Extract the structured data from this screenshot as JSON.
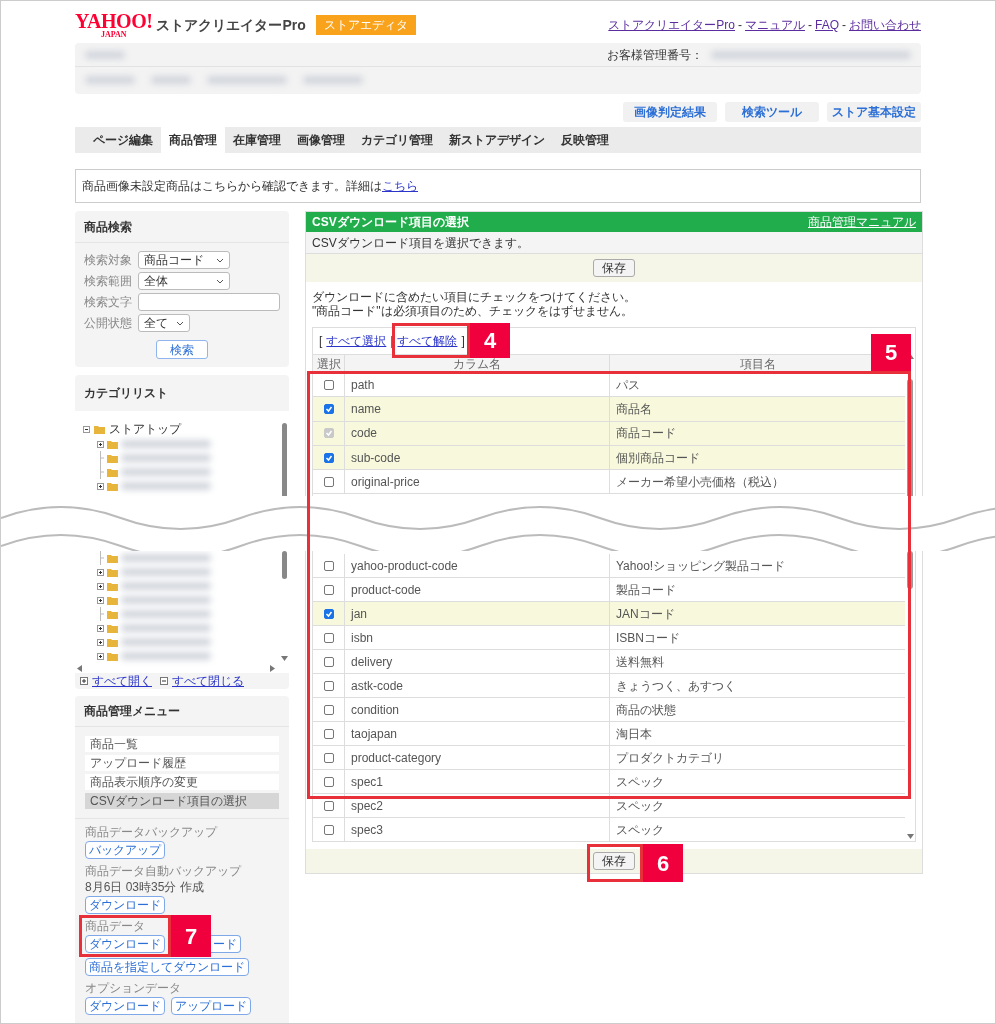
{
  "header": {
    "logo": {
      "main": "YAHOO!",
      "sub": "JAPAN"
    },
    "product": "ストアクリエイターPro",
    "badge": "ストアエディタ",
    "separator": "-",
    "links": [
      "ストアクリエイターPro",
      "マニュアル",
      "FAQ",
      "お問い合わせ"
    ]
  },
  "account": {
    "label": "お客様管理番号："
  },
  "tool_buttons": [
    "画像判定結果",
    "検索ツール",
    "ストア基本設定"
  ],
  "tabs": [
    {
      "label": "ページ編集",
      "selected": false
    },
    {
      "label": "商品管理",
      "selected": true
    },
    {
      "label": "在庫管理",
      "selected": false
    },
    {
      "label": "画像管理",
      "selected": false
    },
    {
      "label": "カテゴリ管理",
      "selected": false
    },
    {
      "label": "新ストアデザイン",
      "selected": false
    },
    {
      "label": "反映管理",
      "selected": false
    }
  ],
  "notice": {
    "text": "商品画像未設定商品はこちらから確認できます。詳細は",
    "link": "こちら"
  },
  "search_panel": {
    "title": "商品検索",
    "button": "検索",
    "fields": [
      {
        "label": "検索対象",
        "kind": "select",
        "value": "商品コード"
      },
      {
        "label": "検索範囲",
        "kind": "select",
        "value": "全体"
      },
      {
        "label": "検索文字",
        "kind": "text"
      },
      {
        "label": "公開状態",
        "kind": "select",
        "value": "全て"
      }
    ]
  },
  "category_panel": {
    "title": "カテゴリリスト",
    "root": "ストアトップ",
    "expand_all": "すべて開く",
    "collapse_all": "すべて閉じる",
    "nodes_top": [
      {
        "expandable": true
      },
      {
        "expandable": false
      },
      {
        "expandable": false
      },
      {
        "expandable": true
      }
    ],
    "nodes_bottom": [
      {
        "expandable": false
      },
      {
        "expandable": true
      },
      {
        "expandable": true
      },
      {
        "expandable": true
      },
      {
        "expandable": false
      },
      {
        "expandable": true
      },
      {
        "expandable": true
      },
      {
        "expandable": true
      }
    ]
  },
  "menu_panel": {
    "title": "商品管理メニュー",
    "items": [
      {
        "label": "商品一覧",
        "selected": false
      },
      {
        "label": "アップロード履歴",
        "selected": false
      },
      {
        "label": "商品表示順序の変更",
        "selected": false
      },
      {
        "label": "CSVダウンロード項目の選択",
        "selected": true
      }
    ],
    "sections": [
      {
        "label": "商品データバックアップ",
        "buttons": [
          "バックアップ"
        ]
      },
      {
        "label": "商品データ自動バックアップ",
        "note": "8月6日 03時35分 作成",
        "buttons": [
          "ダウンロード"
        ]
      },
      {
        "label": "商品データ",
        "buttons": [
          "ダウンロード",
          "ード"
        ]
      },
      {
        "buttons": [
          "商品を指定してダウンロード"
        ]
      },
      {
        "label": "オプションデータ",
        "buttons": [
          "ダウンロード",
          "アップロード"
        ]
      }
    ]
  },
  "csv_panel": {
    "title": "CSVダウンロード項目の選択",
    "manual_link": "商品管理マニュアル",
    "description": "CSVダウンロード項目を選択できます。",
    "save": "保存",
    "instructions": [
      "ダウンロードに含めたい項目にチェックをつけてください。",
      "\"商品コード\"は必須項目のため、チェックをはずせません。"
    ],
    "bracket_open": "[",
    "bracket_sep": "|",
    "bracket_close": "]",
    "select_all": "すべて選択",
    "deselect_all": "すべて解除",
    "columns": [
      "選択",
      "カラム名",
      "項目名"
    ],
    "rows_top": [
      {
        "column": "path",
        "item": "パス",
        "checked": false,
        "disabled": false
      },
      {
        "column": "name",
        "item": "商品名",
        "checked": true,
        "disabled": false
      },
      {
        "column": "code",
        "item": "商品コード",
        "checked": true,
        "disabled": true
      },
      {
        "column": "sub-code",
        "item": "個別商品コード",
        "checked": true,
        "disabled": false
      },
      {
        "column": "original-price",
        "item": "メーカー希望小売価格（税込）",
        "checked": false,
        "disabled": false
      }
    ],
    "rows_bottom": [
      {
        "column": "yahoo-product-code",
        "item": "Yahoo!ショッピング製品コード",
        "checked": false,
        "disabled": false
      },
      {
        "column": "product-code",
        "item": "製品コード",
        "checked": false,
        "disabled": false
      },
      {
        "column": "jan",
        "item": "JANコード",
        "checked": true,
        "disabled": false
      },
      {
        "column": "isbn",
        "item": "ISBNコード",
        "checked": false,
        "disabled": false
      },
      {
        "column": "delivery",
        "item": "送料無料",
        "checked": false,
        "disabled": false
      },
      {
        "column": "astk-code",
        "item": "きょうつく、あすつく",
        "checked": false,
        "disabled": false
      },
      {
        "column": "condition",
        "item": "商品の状態",
        "checked": false,
        "disabled": false
      },
      {
        "column": "taojapan",
        "item": "淘日本",
        "checked": false,
        "disabled": false
      },
      {
        "column": "product-category",
        "item": "プロダクトカテゴリ",
        "checked": false,
        "disabled": false
      },
      {
        "column": "spec1",
        "item": "スペック",
        "checked": false,
        "disabled": false
      },
      {
        "column": "spec2",
        "item": "スペック",
        "checked": false,
        "disabled": false
      },
      {
        "column": "spec3",
        "item": "スペック",
        "checked": false,
        "disabled": false
      }
    ],
    "footer_save": "保存"
  },
  "annotations": [
    {
      "number": "4"
    },
    {
      "number": "5"
    },
    {
      "number": "6"
    },
    {
      "number": "7"
    }
  ]
}
